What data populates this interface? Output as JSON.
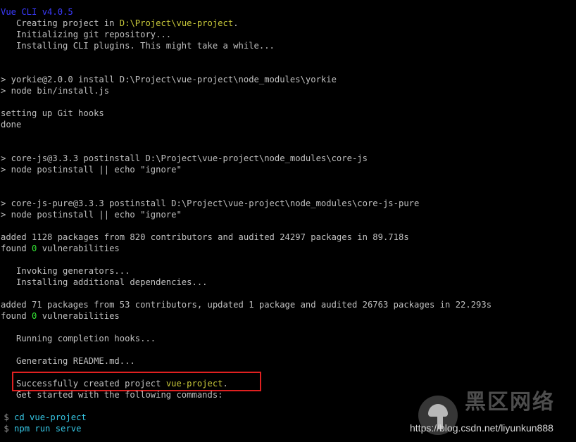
{
  "lines": {
    "l1": "Vue CLI v4.0.5",
    "l2_a": "   Creating project in ",
    "l2_b": "D:\\Project\\vue-project",
    "l2_c": ".",
    "l3": "   Initializing git repository...",
    "l4": "   Installing CLI plugins. This might take a while...",
    "l5": "> yorkie@2.0.0 install D:\\Project\\vue-project\\node_modules\\yorkie",
    "l6": "> node bin/install.js",
    "l7": "setting up Git hooks",
    "l8": "done",
    "l9": "> core-js@3.3.3 postinstall D:\\Project\\vue-project\\node_modules\\core-js",
    "l10": "> node postinstall || echo \"ignore\"",
    "l11": "> core-js-pure@3.3.3 postinstall D:\\Project\\vue-project\\node_modules\\core-js-pure",
    "l12": "> node postinstall || echo \"ignore\"",
    "l13": "added 1128 packages from 820 contributors and audited 24297 packages in 89.718s",
    "l14_a": "found ",
    "l14_b": "0",
    "l14_c": " vulnerabilities",
    "l15": "   Invoking generators...",
    "l16": "   Installing additional dependencies...",
    "l17": "added 71 packages from 53 contributors, updated 1 package and audited 26763 packages in 22.293s",
    "l18_a": "found ",
    "l18_b": "0",
    "l18_c": " vulnerabilities",
    "l19": "   Running completion hooks...",
    "l20": "   Generating README.md...",
    "l21_a": "   Successfully created project ",
    "l21_b": "vue-project",
    "l21_c": ".",
    "l22": "   Get started with the following commands:",
    "l23_prompt": " $ ",
    "l23_cmd": "cd vue-project",
    "l24_prompt": " $ ",
    "l24_cmd": "npm run serve"
  },
  "watermark": {
    "text": "黑区网络",
    "url": "https://blog.csdn.net/liyunkun888"
  },
  "colors": {
    "background": "#000000",
    "text": "#c0c0c0",
    "title": "#3b3bff",
    "path": "#c8c83a",
    "zero": "#34e234",
    "command": "#36c8e6",
    "highlight_border": "#e02020"
  }
}
